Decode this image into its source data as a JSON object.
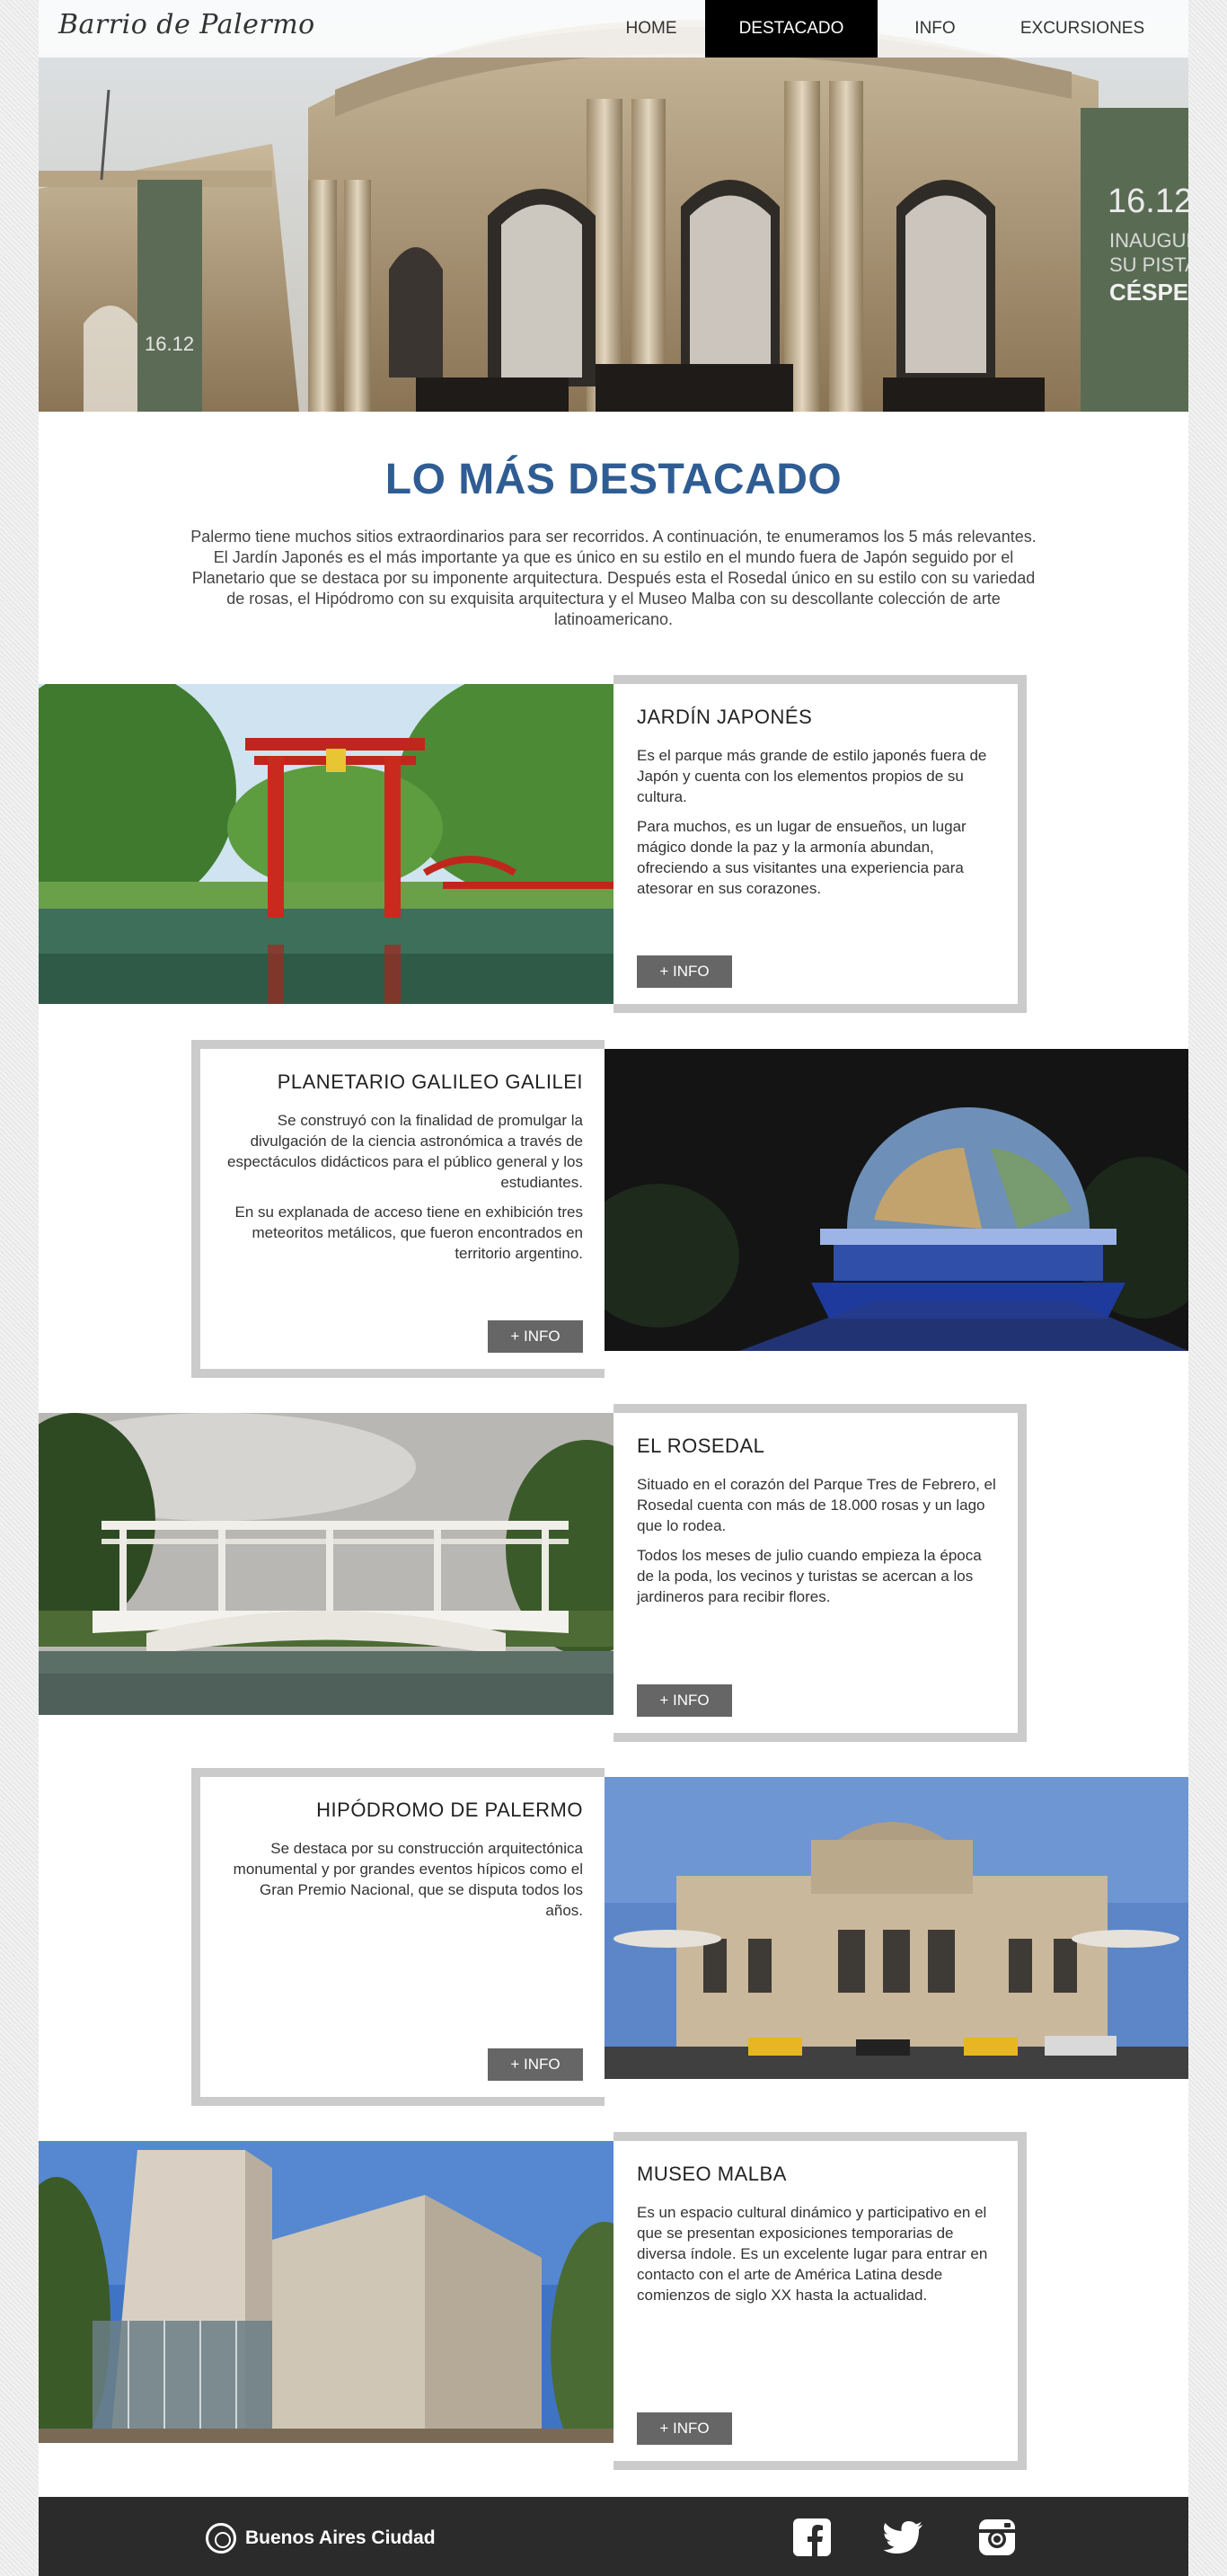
{
  "header": {
    "logo": "Barrio de Palermo",
    "nav": [
      {
        "label": "HOME",
        "active": false
      },
      {
        "label": "DESTACADO",
        "active": true
      },
      {
        "label": "INFO",
        "active": false
      },
      {
        "label": "EXCURSIONES",
        "active": false
      }
    ],
    "hero_banner_text": [
      "16.12",
      "INAUGURA",
      "SU PISTA",
      "CÉSPED"
    ]
  },
  "intro": {
    "title": "LO MÁS DESTACADO",
    "text": "Palermo tiene muchos sitios extraordinarios para ser recorridos. A continuación, te enumeramos los 5 más relevantes. El Jardín Japonés es el más importante ya que es único en su estilo en el mundo fuera de Japón seguido por el Planetario que se destaca por su imponente arquitectura. Después esta el Rosedal único en su estilo con su variedad de rosas, el Hipódromo con su exquisita arquitectura y el Museo Malba con su descollante colección de arte latinoamericano."
  },
  "cards": [
    {
      "title": "JARDÍN JAPONÉS",
      "paragraphs": [
        "Es el parque más grande de estilo japonés fuera de Japón y cuenta con los elementos propios de su cultura.",
        "Para muchos, es un lugar de ensueños, un lugar mágico donde la paz y la armonía abundan, ofreciendo a sus visitantes una experiencia para atesorar en sus corazones."
      ],
      "button": "+ INFO"
    },
    {
      "title": "PLANETARIO GALILEO GALILEI",
      "paragraphs": [
        "Se construyó con la finalidad de promulgar la divulgación de la ciencia astronómica a través de espectáculos didácticos para el público general y los estudiantes.",
        "En su explanada de acceso tiene en exhibición tres meteoritos metálicos, que fueron encontrados en territorio argentino."
      ],
      "button": "+ INFO"
    },
    {
      "title": "EL ROSEDAL",
      "paragraphs": [
        "Situado en el corazón del Parque Tres de Febrero, el Rosedal cuenta con más de 18.000 rosas y un lago que lo rodea.",
        "Todos los meses de julio cuando empieza la época de la poda, los vecinos y turistas se acercan a los jardineros para recibir flores."
      ],
      "button": "+ INFO"
    },
    {
      "title": "HIPÓDROMO DE PALERMO",
      "paragraphs": [
        "Se destaca por su construcción arquitectónica monumental y por grandes eventos hípicos como el Gran Premio Nacional, que se disputa todos los años."
      ],
      "button": "+ INFO"
    },
    {
      "title": "MUSEO MALBA",
      "paragraphs": [
        "Es un espacio cultural dinámico y participativo en el que se presentan exposiciones temporarias de diversa índole. Es un excelente lugar para entrar en contacto con el arte de América Latina desde comienzos de siglo XX hasta la actualidad."
      ],
      "button": "+ INFO"
    }
  ],
  "footer": {
    "brand": "Buenos Aires Ciudad",
    "social_icons": [
      "facebook-icon",
      "twitter-icon",
      "instagram-icon"
    ]
  },
  "colors": {
    "title_blue": "#2f5d93",
    "nav_active_bg": "#000000",
    "button_bg": "#666666",
    "card_border": "#cbcbcb",
    "footer_bg": "#2b2b2b"
  }
}
